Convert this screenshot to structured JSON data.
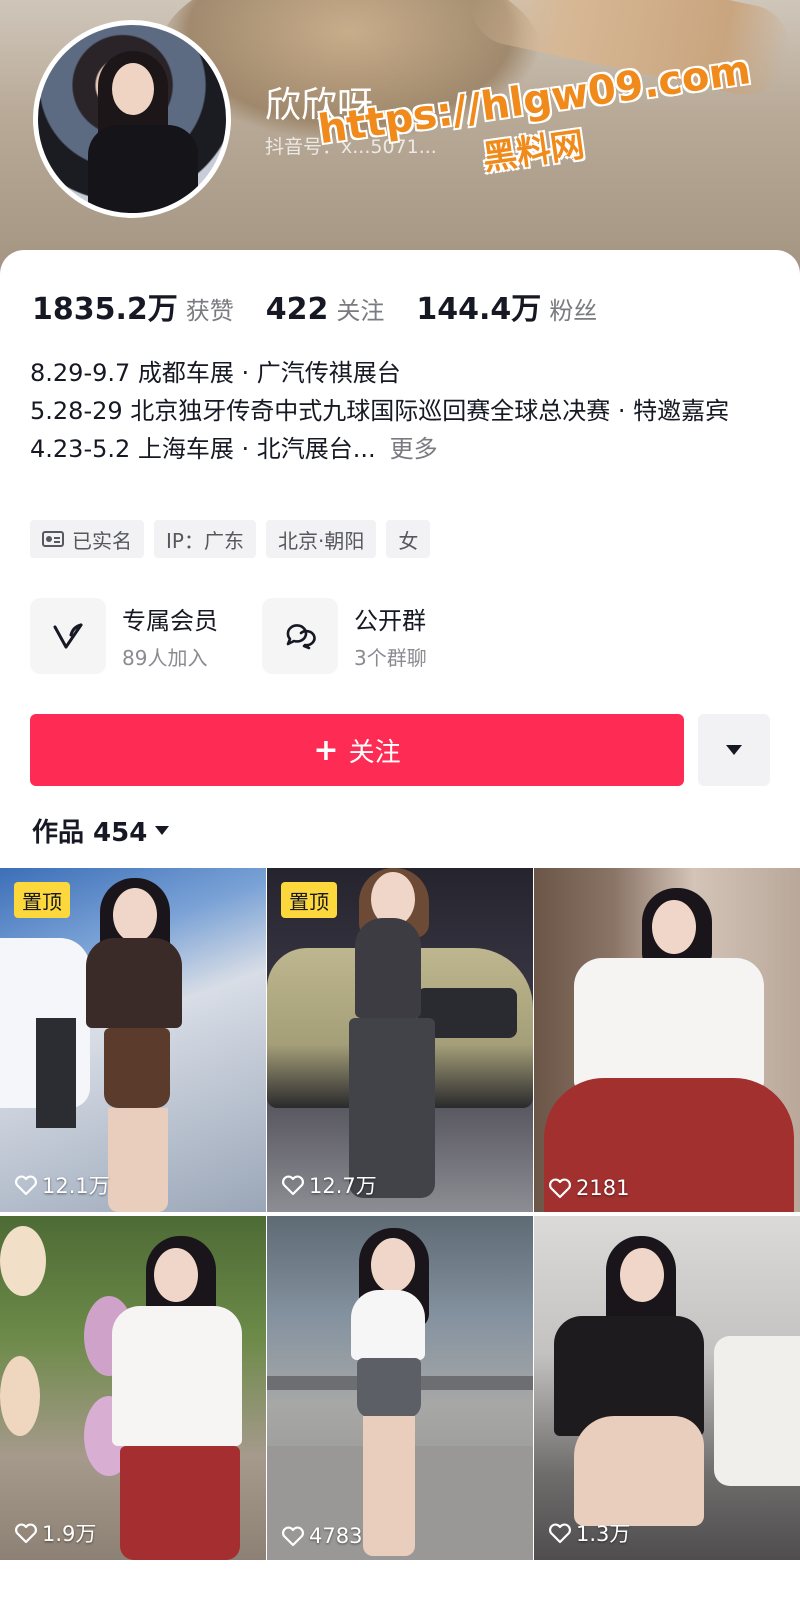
{
  "profile": {
    "nickname": "欣欣呀",
    "douyin_id_label": "抖音号：",
    "douyin_id_value": "x...5071..."
  },
  "watermark": {
    "url": "https://hlgw09.com",
    "name": "黑料网"
  },
  "stats": [
    {
      "value": "1835.2万",
      "label": "获赞"
    },
    {
      "value": "422",
      "label": "关注"
    },
    {
      "value": "144.4万",
      "label": "粉丝"
    }
  ],
  "bio": {
    "line1": "8.29-9.7 成都车展 · 广汽传祺展台",
    "line2": "5.28-29 北京独牙传奇中式九球国际巡回赛全球总决赛 · 特邀嘉宾",
    "line3": "4.23-5.2 上海车展 · 北汽展台...",
    "more": "更多"
  },
  "tags": [
    "已实名",
    "IP：广东",
    "北京·朝阳",
    "女"
  ],
  "features": [
    {
      "title": "专属会员",
      "sub": "89人加入",
      "icon": "v-badge-icon"
    },
    {
      "title": "公开群",
      "sub": "3个群聊",
      "icon": "chat-bubbles-icon"
    }
  ],
  "actions": {
    "follow_label": "关注",
    "follow_plus": "+"
  },
  "works": {
    "label": "作品 454"
  },
  "grid": [
    {
      "pinned": true,
      "pin_label": "置顶",
      "likes": "12.1万"
    },
    {
      "pinned": true,
      "pin_label": "置顶",
      "likes": "12.7万"
    },
    {
      "pinned": false,
      "likes": "2181"
    },
    {
      "pinned": false,
      "likes": "1.9万"
    },
    {
      "pinned": false,
      "likes": "4783"
    },
    {
      "pinned": false,
      "likes": "1.3万"
    }
  ],
  "colors": {
    "accent": "#fe2c55",
    "pin_badge": "#fdd83c",
    "watermark": "#f08a1a"
  }
}
